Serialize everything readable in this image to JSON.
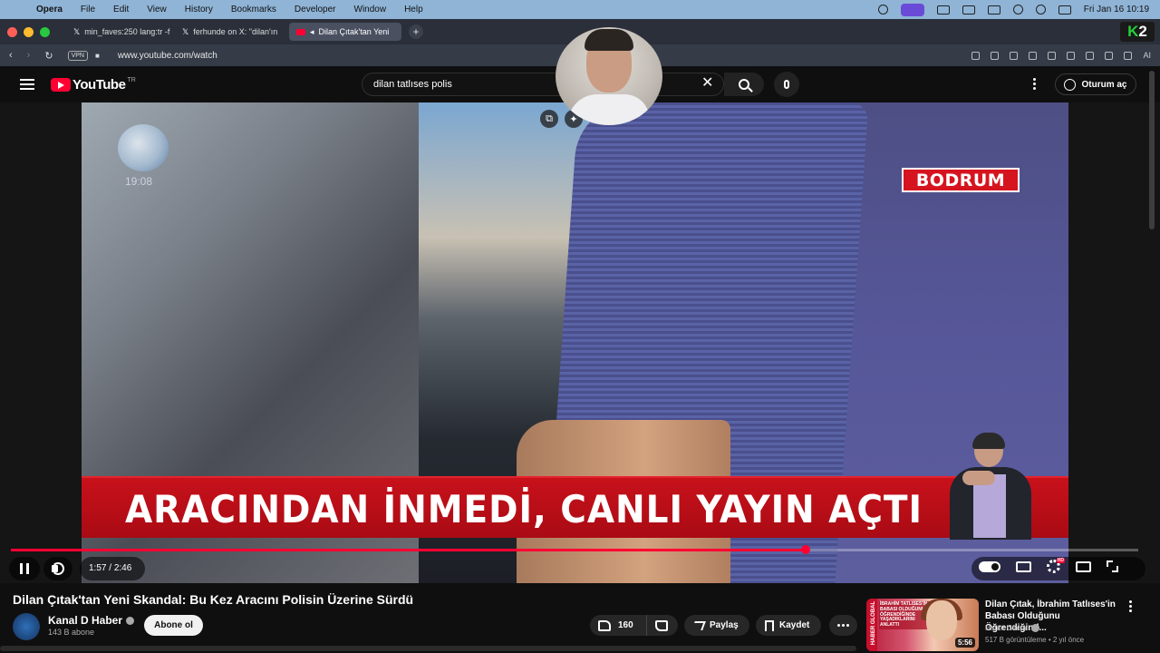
{
  "menubar": {
    "app": "Opera",
    "menus": [
      "File",
      "Edit",
      "View",
      "History",
      "Bookmarks",
      "Developer",
      "Window",
      "Help"
    ],
    "datetime": "Fri Jan 16  10:19"
  },
  "browser": {
    "tabs": [
      {
        "label": "min_faves:250 lang:tr -f",
        "icon": "x-logo-icon"
      },
      {
        "label": "ferhunde on X: \"dilan'ın",
        "icon": "x-logo-icon"
      },
      {
        "label": "Dilan Çıtak'tan Yeni",
        "icon": "youtube-icon",
        "active": true
      }
    ],
    "new_tab": "+",
    "vpn": "VPN",
    "url": "www.youtube.com/watch",
    "ai_label": "AI",
    "overlay_logo": {
      "k": "K",
      "two": "2"
    }
  },
  "youtube": {
    "logo_text": "YouTube",
    "region": "TR",
    "search_value": "dilan tatlıses polis",
    "clear": "✕",
    "signin": "Oturum aç"
  },
  "video": {
    "bodrum_tag": "BODRUM",
    "headline": "ARACINDAN İNMEDİ, CANLI YAYIN AÇTI",
    "channel_clock": "19:08",
    "current_time": "1:57",
    "duration": "2:46",
    "progress_fraction": 0.705,
    "hd_badge": "HD",
    "title": "Dilan Çıtak'tan Yeni Skandal: Bu Kez Aracını Polisin Üzerine Sürdü",
    "channel": "Kanal D Haber",
    "subscribers": "143 B abone",
    "subscribe_label": "Abone ol",
    "likes": "160",
    "share_label": "Paylaş",
    "save_label": "Kaydet"
  },
  "recommendation": {
    "title": "Dilan Çıtak, İbrahim Tatlıses'in Babası Olduğunu Öğrendiğind...",
    "channel": "Haber Global",
    "views": "517 B görüntüleme",
    "age": "2 yıl önce",
    "duration": "5:56",
    "band_text": "HABER GLOBAL",
    "thumb_caption": "İBRAHİM TATLISES'İN BABASI OLDUĞUNU ÖĞRENDİĞİNDE YAŞADIKLARINI ANLATTI"
  },
  "colors": {
    "accent": "#ff0033",
    "menubar": "#8fb4d6",
    "headline_band": "#c8111b"
  }
}
